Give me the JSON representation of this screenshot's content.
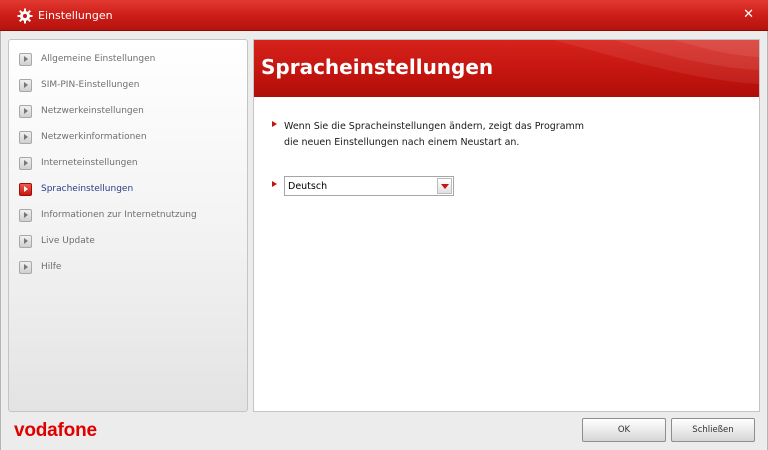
{
  "window": {
    "title": "Einstellungen"
  },
  "sidebar": {
    "items": [
      {
        "label": "Allgemeine Einstellungen",
        "active": false
      },
      {
        "label": "SIM-PIN-Einstellungen",
        "active": false
      },
      {
        "label": "Netzwerkeinstellungen",
        "active": false
      },
      {
        "label": "Netzwerkinformationen",
        "active": false
      },
      {
        "label": "Interneteinstellungen",
        "active": false
      },
      {
        "label": "Spracheinstellungen",
        "active": true
      },
      {
        "label": "Informationen zur Internetnutzung",
        "active": false
      },
      {
        "label": "Live Update",
        "active": false
      },
      {
        "label": "Hilfe",
        "active": false
      }
    ]
  },
  "content": {
    "heading": "Spracheinstellungen",
    "info_line1": "Wenn Sie die Spracheinstellungen ändern, zeigt das Programm",
    "info_line2": "die neuen Einstellungen nach einem Neustart an.",
    "language_select": {
      "value": "Deutsch"
    }
  },
  "footer": {
    "logo": "vodafone",
    "ok_label": "OK",
    "close_label": "Schließen"
  },
  "colors": {
    "brand_red": "#c3140f",
    "active_nav_text": "#283e8a"
  }
}
